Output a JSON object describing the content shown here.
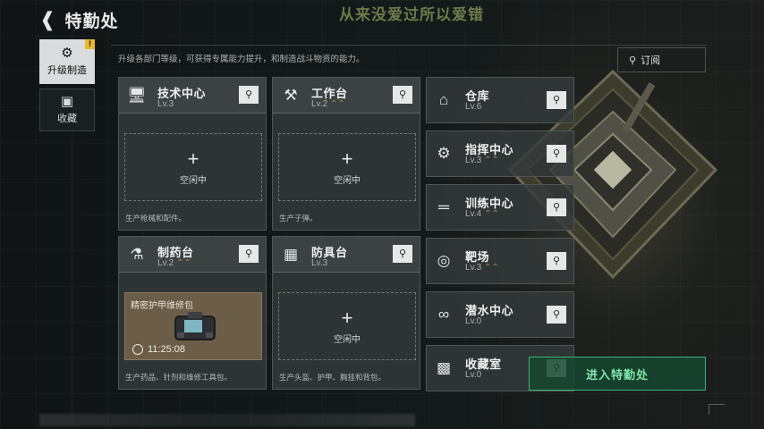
{
  "header": {
    "title": "特勤处",
    "banner": "从来没爱过所以爱错"
  },
  "side_tabs": [
    {
      "label": "升级制造",
      "icon": "gear-plus-icon",
      "badge": "!"
    },
    {
      "label": "收藏",
      "icon": "trophy-cabinet-icon"
    }
  ],
  "description": "升级各部门等级，可获得专属能力提升，和制造战斗物资的能力。",
  "subscribe_label": "订阅",
  "facilities": [
    {
      "name": "技术中心",
      "level": "Lv.3",
      "icon": "monitor-icon",
      "status": "空闲中",
      "desc": "生产枪械和配件。"
    },
    {
      "name": "工作台",
      "level": "Lv.2",
      "icon": "tools-icon",
      "status": "空闲中",
      "desc": "生产子弹。"
    },
    {
      "name": "制药台",
      "level": "Lv.2",
      "icon": "microscope-icon",
      "job_name": "精密护甲维修包",
      "timer": "11:25:08",
      "desc": "生产药品、针剂和维修工具包。"
    },
    {
      "name": "防具台",
      "level": "Lv.3",
      "icon": "armor-boxes-icon",
      "status": "空闲中",
      "desc": "生产头盔、护甲、胸挂和背包。"
    }
  ],
  "side_facilities": [
    {
      "name": "仓库",
      "level": "Lv.6",
      "icon": "warehouse-icon"
    },
    {
      "name": "指挥中心",
      "level": "Lv.3",
      "icon": "command-gear-icon"
    },
    {
      "name": "训练中心",
      "level": "Lv.4",
      "icon": "dumbbell-icon"
    },
    {
      "name": "靶场",
      "level": "Lv.3",
      "icon": "target-icon"
    },
    {
      "name": "潜水中心",
      "level": "Lv.0",
      "icon": "diving-mask-icon"
    },
    {
      "name": "收藏室",
      "level": "Lv.0",
      "icon": "display-case-icon"
    }
  ],
  "enter_button": "进入特勤处"
}
